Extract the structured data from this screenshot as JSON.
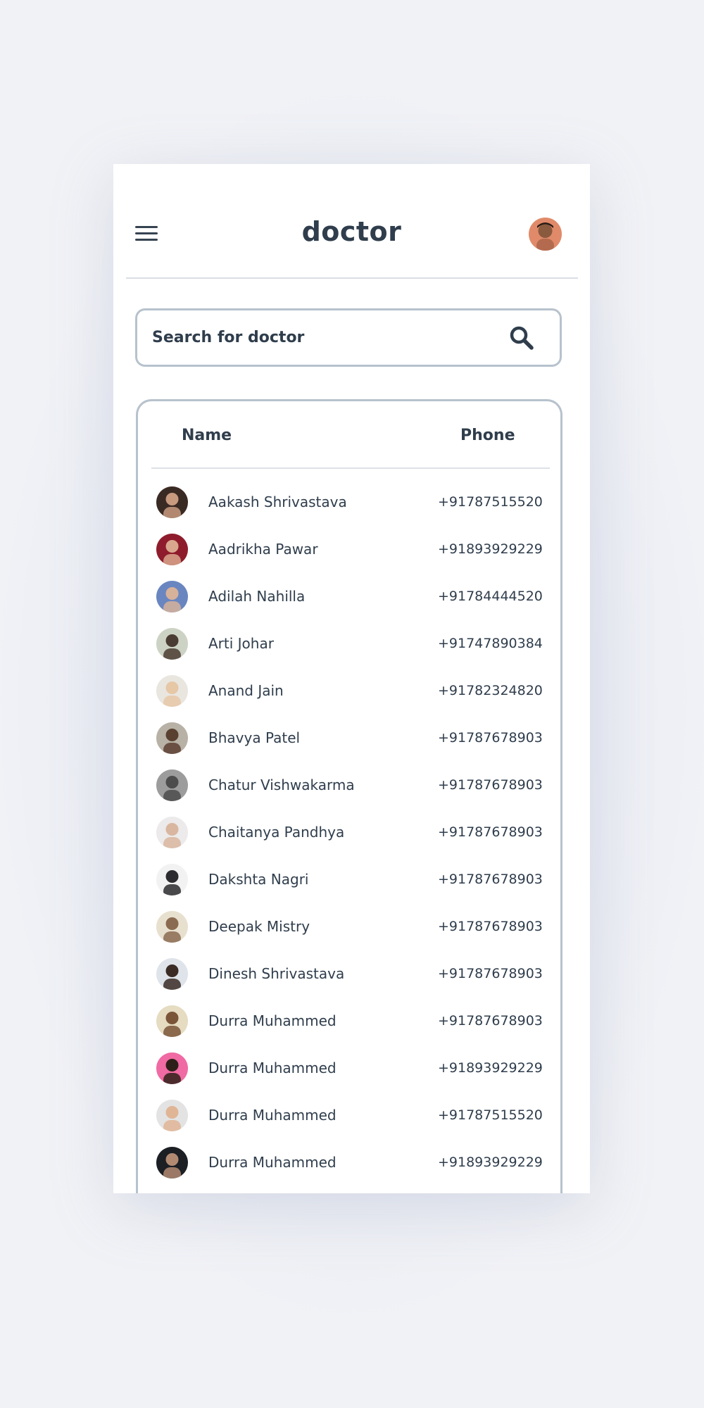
{
  "app": {
    "title": "doctor"
  },
  "search": {
    "placeholder": "Search for doctor"
  },
  "table": {
    "columns": [
      "Name",
      "Phone"
    ],
    "rows": [
      {
        "name": "Aakash Shrivastava",
        "phone": "+91787515520",
        "avatar_colors": [
          "#3a2a24",
          "#c89a7e"
        ]
      },
      {
        "name": "Aadrikha Pawar",
        "phone": "+91893929229",
        "avatar_colors": [
          "#8e1c2c",
          "#d9a78d"
        ]
      },
      {
        "name": "Adilah Nahilla",
        "phone": "+91784444520",
        "avatar_colors": [
          "#6a86c0",
          "#d6b29a"
        ]
      },
      {
        "name": "Arti Johar",
        "phone": "+91747890384",
        "avatar_colors": [
          "#cdd3c4",
          "#4b3c33"
        ]
      },
      {
        "name": "Anand Jain",
        "phone": "+91782324820",
        "avatar_colors": [
          "#e9e6e0",
          "#e6c7a6"
        ]
      },
      {
        "name": "Bhavya Patel",
        "phone": "+91787678903",
        "avatar_colors": [
          "#b8b1a6",
          "#5a4030"
        ]
      },
      {
        "name": "Chatur Vishwakarma",
        "phone": "+91787678903",
        "avatar_colors": [
          "#9c9c9c",
          "#4c4c4c"
        ]
      },
      {
        "name": "Chaitanya Pandhya",
        "phone": "+91787678903",
        "avatar_colors": [
          "#eceaea",
          "#d9b69f"
        ]
      },
      {
        "name": "Dakshta Nagri",
        "phone": "+91787678903",
        "avatar_colors": [
          "#f2f2f2",
          "#2c2b2f"
        ]
      },
      {
        "name": "Deepak Mistry",
        "phone": "+91787678903",
        "avatar_colors": [
          "#e8e0cf",
          "#8a6a50"
        ]
      },
      {
        "name": "Dinesh Shrivastava",
        "phone": "+91787678903",
        "avatar_colors": [
          "#dfe4ea",
          "#3a2c25"
        ]
      },
      {
        "name": "Durra Muhammed",
        "phone": "+91787678903",
        "avatar_colors": [
          "#e5dcc1",
          "#7a5538"
        ]
      },
      {
        "name": "Durra Muhammed",
        "phone": "+91893929229",
        "avatar_colors": [
          "#f06aa3",
          "#2e2018"
        ]
      },
      {
        "name": "Durra Muhammed",
        "phone": "+91787515520",
        "avatar_colors": [
          "#e3e3e3",
          "#e0b596"
        ]
      },
      {
        "name": "Durra Muhammed",
        "phone": "+91893929229",
        "avatar_colors": [
          "#1c1f24",
          "#b28a72"
        ]
      }
    ]
  },
  "colors": {
    "text": "#2f3d4c",
    "border": "#b7c2cd",
    "divider": "#d9dde3",
    "card": "#ffffff"
  },
  "icons": {
    "menu": "hamburger-menu-icon",
    "search": "search-icon",
    "profile": "user-avatar"
  }
}
